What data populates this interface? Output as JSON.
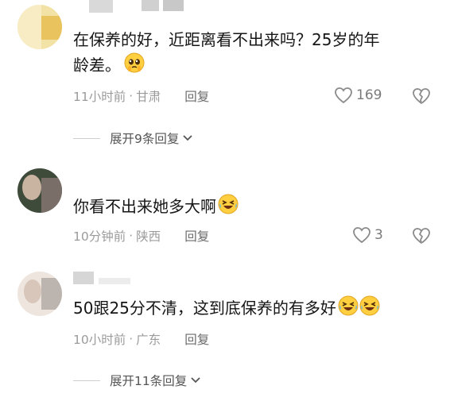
{
  "comments": [
    {
      "text_line1": "在保养的好，近距离看不出来吗？25岁的年",
      "text_line2": "龄差。",
      "time": "11小时前",
      "location": "甘肃",
      "reply_label": "回复",
      "likes": "169"
    },
    {
      "text": "你看不出来她多大啊",
      "time": "10分钟前",
      "location": "陕西",
      "reply_label": "回复",
      "likes": "3"
    },
    {
      "text": "50跟25分不清，这到底保养的有多好",
      "time": "10小时前",
      "location": "广东",
      "reply_label": "回复"
    }
  ],
  "expand_replies": [
    {
      "label": "展开9条回复"
    },
    {
      "label": "展开11条回复"
    }
  ],
  "separator": "·",
  "icons": {
    "like": "heart-outline-icon",
    "dislike": "broken-heart-icon",
    "expand": "chevron-down-icon",
    "emoji_pray": "pleading-emoji-icon",
    "emoji_laugh": "laugh-cry-emoji-icon"
  },
  "colors": {
    "text": "#161616",
    "meta": "#9b9b9b",
    "reply": "#6b6b6b",
    "expand": "#555555"
  }
}
